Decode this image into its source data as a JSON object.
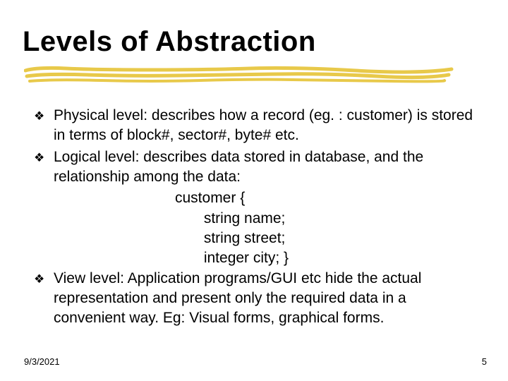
{
  "title": "Levels of Abstraction",
  "bullets": [
    {
      "text": "Physical level: describes how a record (eg. : customer) is stored in terms of block#, sector#, byte# etc."
    },
    {
      "text": "Logical level: describes data stored in database, and the relationship among the data:",
      "code": [
        "customer {",
        "       string name;",
        "       string street;",
        "       integer city; }"
      ]
    },
    {
      "text": "View level: Application programs/GUI etc hide the actual representation and present only the required data in a convenient way. Eg: Visual forms, graphical forms."
    }
  ],
  "bullet_glyph": "❖",
  "footer": {
    "date": "9/3/2021",
    "page": "5"
  }
}
